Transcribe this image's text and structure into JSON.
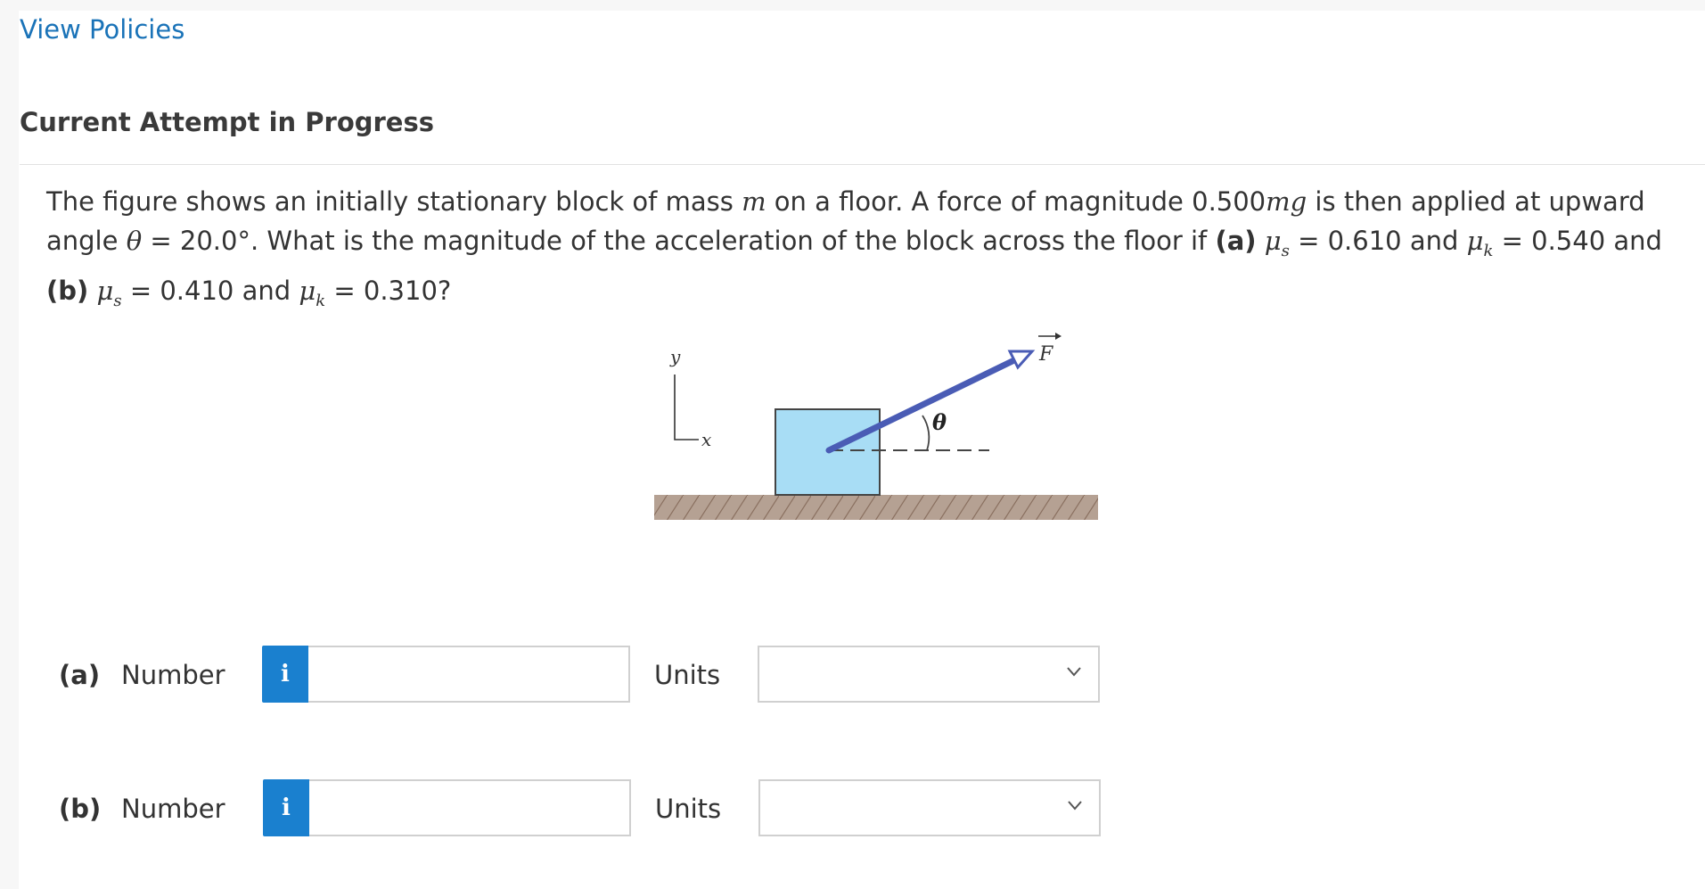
{
  "header": {
    "view_policies": "View Policies",
    "attempt_title": "Current Attempt in Progress"
  },
  "question": {
    "t1": "The figure shows an initially stationary block of mass ",
    "m": "m",
    "t2": " on a floor. A force of magnitude 0.500",
    "mg": "mg",
    "t3": " is then applied at upward angle ",
    "theta": "θ",
    "t4": " = 20.0°. What is the magnitude of the acceleration of the block across the floor if ",
    "a_tag": "(a)",
    "mu": "μ",
    "s": "s",
    "k": "k",
    "t5": " = 0.610 and ",
    "t6": " = 0.540 and ",
    "b_tag": "(b)",
    "t7": " = 0.410 and ",
    "t8": " = 0.310?"
  },
  "figure": {
    "y_label": "y",
    "x_label": "x",
    "f_label": "F",
    "theta_label": "θ",
    "block_color": "#a8ddf5",
    "arrow_color": "#4a5cb5",
    "floor_color": "#a89080"
  },
  "answers": [
    {
      "part": "(a)",
      "field_label": "Number",
      "info": "i",
      "value": "",
      "units_label": "Units",
      "units_value": ""
    },
    {
      "part": "(b)",
      "field_label": "Number",
      "info": "i",
      "value": "",
      "units_label": "Units",
      "units_value": ""
    }
  ],
  "colors": {
    "accent": "#1a80cf",
    "link": "#1a73b8"
  }
}
